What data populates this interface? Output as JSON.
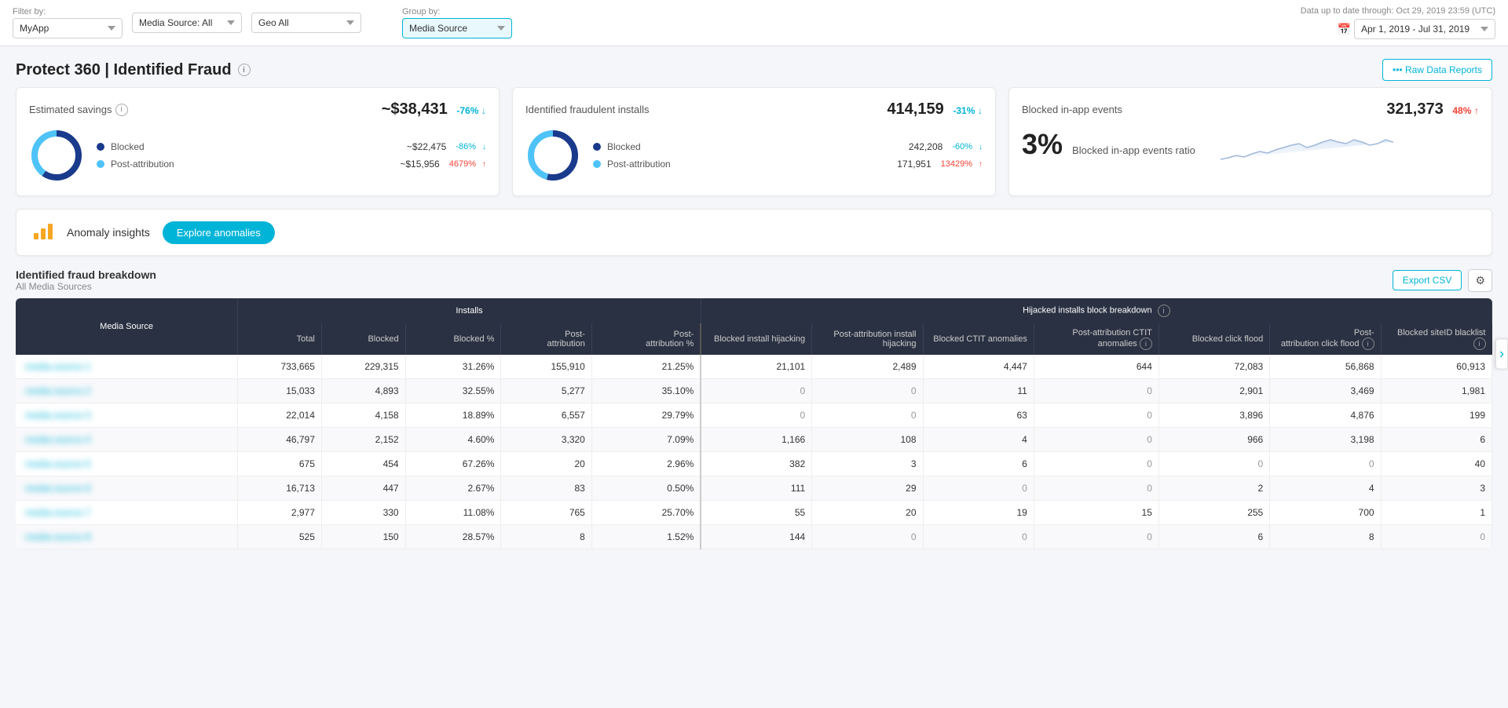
{
  "filterBar": {
    "filterLabel": "Filter by:",
    "groupByLabel": "Group by:",
    "appSelect": "MyApp",
    "mediaSourceSelect": "Media Source: All",
    "geoSelect": "Geo All",
    "groupBySelect": "Media Source",
    "dataUpToDate": "Data up to date through: Oct 29, 2019 23:59 (UTC)",
    "dateRange": "Apr 1, 2019 - Jul 31, 2019"
  },
  "page": {
    "title": "Protect 360 | Identified Fraud",
    "rawDataBtn": "••• Raw Data Reports"
  },
  "estimatedSavings": {
    "title": "Estimated savings",
    "totalValue": "~$38,431",
    "totalChange": "-76%",
    "blockedLabel": "Blocked",
    "blockedValue": "~$22,475",
    "blockedChange": "-86%",
    "postAttrLabel": "Post-attribution",
    "postAttrValue": "~$15,956",
    "postAttrChange": "4679%"
  },
  "identifiedFraud": {
    "title": "Identified fraudulent installs",
    "totalValue": "414,159",
    "totalChange": "-31%",
    "blockedLabel": "Blocked",
    "blockedValue": "242,208",
    "blockedChange": "-60%",
    "postAttrLabel": "Post-attribution",
    "postAttrValue": "171,951",
    "postAttrChange": "13429%"
  },
  "blockedInApp": {
    "title": "Blocked in-app events",
    "totalValue": "321,373",
    "totalChange": "48%",
    "ratioValue": "3%",
    "ratioLabel": "Blocked in-app events ratio"
  },
  "anomalyBar": {
    "label": "Anomaly insights",
    "btnLabel": "Explore anomalies"
  },
  "breakdown": {
    "title": "Identified fraud breakdown",
    "subtitle": "All Media Sources",
    "exportBtn": "Export CSV",
    "columns": {
      "mediaSource": "Media Source",
      "installsGroup": "Installs",
      "hijackedGroup": "Hijacked installs block breakdown",
      "total": "Total",
      "blocked": "Blocked",
      "blockedPct": "Blocked %",
      "postAttribution": "Post-attribution",
      "postAttributionPct": "Post-attribution %",
      "blockedInstallHijacking": "Blocked install hijacking",
      "postAttrInstallHijacking": "Post-attribution install hijacking",
      "blockedCTIT": "Blocked CTIT anomalies",
      "postAttrCTIT": "Post-attribution CTIT anomalies",
      "blockedClickFlood": "Blocked click flood",
      "postAttrClickFlood": "Post-attribution click flood",
      "blockedSiteID": "Blocked siteID blacklist"
    },
    "rows": [
      {
        "mediaSource": "blurred1",
        "total": "733,665",
        "blocked": "229,315",
        "blockedPct": "31.26%",
        "postAttr": "155,910",
        "postAttrPct": "21.25%",
        "blockedInstHijack": "21,101",
        "postAttrInstHijack": "2,489",
        "blockedCTIT": "4,447",
        "postAttrCTIT": "644",
        "blockedClickFlood": "72,083",
        "postAttrClickFlood": "56,868",
        "blockedSiteID": "60,913"
      },
      {
        "mediaSource": "blurred2",
        "total": "15,033",
        "blocked": "4,893",
        "blockedPct": "32.55%",
        "postAttr": "5,277",
        "postAttrPct": "35.10%",
        "blockedInstHijack": "0",
        "postAttrInstHijack": "0",
        "blockedCTIT": "11",
        "postAttrCTIT": "0",
        "blockedClickFlood": "2,901",
        "postAttrClickFlood": "3,469",
        "blockedSiteID": "1,981"
      },
      {
        "mediaSource": "blurred3",
        "total": "22,014",
        "blocked": "4,158",
        "blockedPct": "18.89%",
        "postAttr": "6,557",
        "postAttrPct": "29.79%",
        "blockedInstHijack": "0",
        "postAttrInstHijack": "0",
        "blockedCTIT": "63",
        "postAttrCTIT": "0",
        "blockedClickFlood": "3,896",
        "postAttrClickFlood": "4,876",
        "blockedSiteID": "199"
      },
      {
        "mediaSource": "blurred4",
        "total": "46,797",
        "blocked": "2,152",
        "blockedPct": "4.60%",
        "postAttr": "3,320",
        "postAttrPct": "7.09%",
        "blockedInstHijack": "1,166",
        "postAttrInstHijack": "108",
        "blockedCTIT": "4",
        "postAttrCTIT": "0",
        "blockedClickFlood": "966",
        "postAttrClickFlood": "3,198",
        "blockedSiteID": "6"
      },
      {
        "mediaSource": "blurred5",
        "total": "675",
        "blocked": "454",
        "blockedPct": "67.26%",
        "postAttr": "20",
        "postAttrPct": "2.96%",
        "blockedInstHijack": "382",
        "postAttrInstHijack": "3",
        "blockedCTIT": "6",
        "postAttrCTIT": "0",
        "blockedClickFlood": "0",
        "postAttrClickFlood": "0",
        "blockedSiteID": "40"
      },
      {
        "mediaSource": "blurred6",
        "total": "16,713",
        "blocked": "447",
        "blockedPct": "2.67%",
        "postAttr": "83",
        "postAttrPct": "0.50%",
        "blockedInstHijack": "111",
        "postAttrInstHijack": "29",
        "blockedCTIT": "0",
        "postAttrCTIT": "0",
        "blockedClickFlood": "2",
        "postAttrClickFlood": "4",
        "blockedSiteID": "3"
      },
      {
        "mediaSource": "blurred7",
        "total": "2,977",
        "blocked": "330",
        "blockedPct": "11.08%",
        "postAttr": "765",
        "postAttrPct": "25.70%",
        "blockedInstHijack": "55",
        "postAttrInstHijack": "20",
        "blockedCTIT": "19",
        "postAttrCTIT": "15",
        "blockedClickFlood": "255",
        "postAttrClickFlood": "700",
        "blockedSiteID": "1"
      },
      {
        "mediaSource": "blurred8",
        "total": "525",
        "blocked": "150",
        "blockedPct": "28.57%",
        "postAttr": "8",
        "postAttrPct": "1.52%",
        "blockedInstHijack": "144",
        "postAttrInstHijack": "0",
        "blockedCTIT": "0",
        "postAttrCTIT": "0",
        "blockedClickFlood": "6",
        "postAttrClickFlood": "8",
        "blockedSiteID": "0"
      }
    ]
  }
}
